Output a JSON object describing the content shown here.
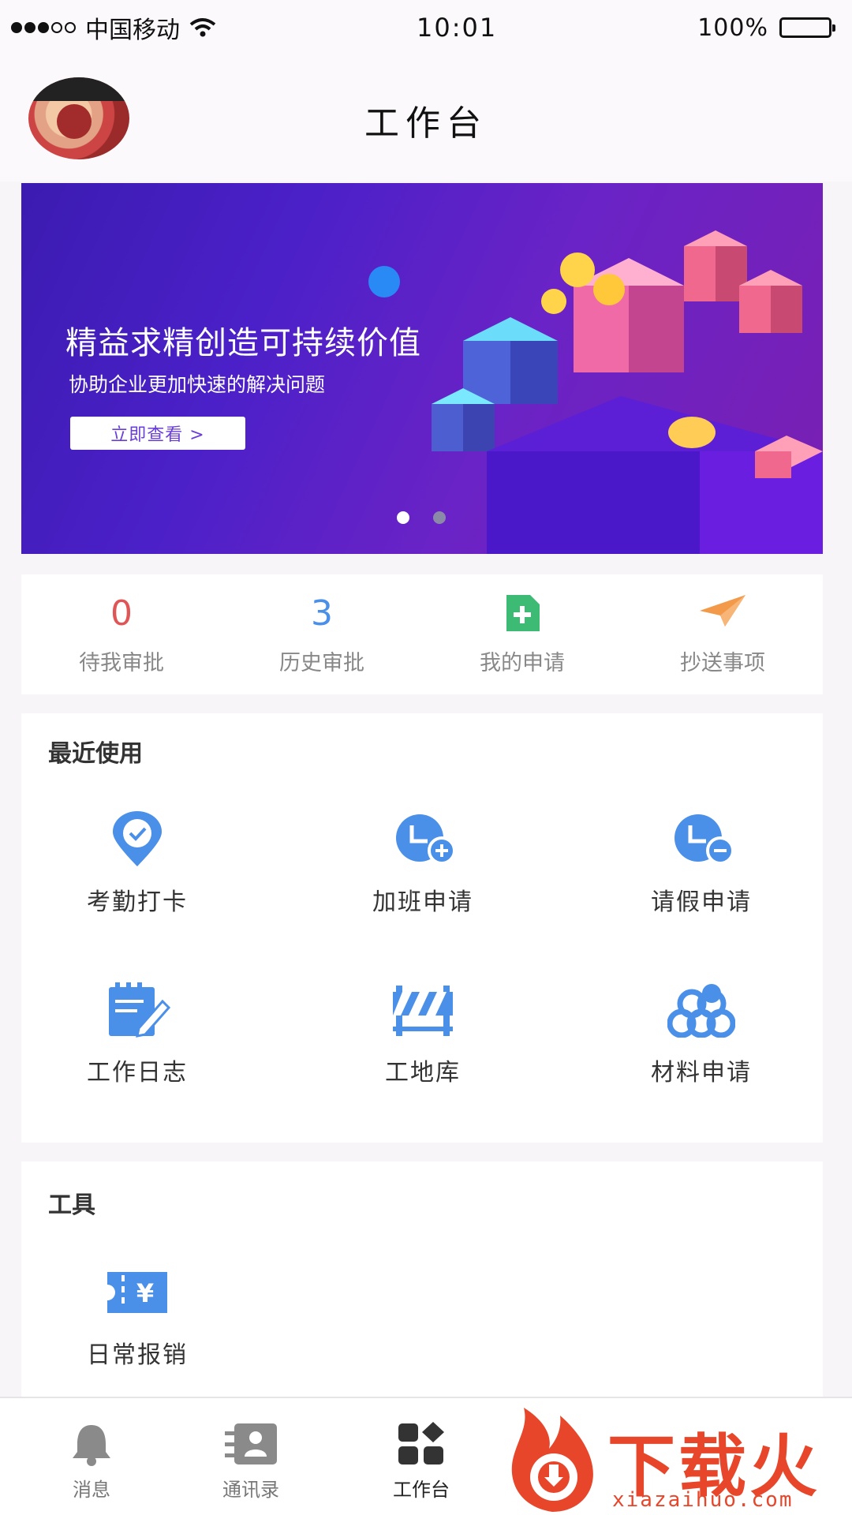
{
  "status_bar": {
    "carrier": "中国移动",
    "time": "10:01",
    "battery": "100%"
  },
  "header": {
    "title": "工作台"
  },
  "banner": {
    "title": "精益求精创造可持续价值",
    "subtitle": "协助企业更加快速的解决问题",
    "button_label": "立即查看 >",
    "active_slide": 1,
    "slide_count": 2
  },
  "stats": [
    {
      "value": "0",
      "label": "待我审批",
      "color": "#e05555"
    },
    {
      "value": "3",
      "label": "历史审批",
      "color": "#4a8fe8"
    },
    {
      "value": "",
      "label": "我的申请",
      "icon": "add-document-icon",
      "color": "#3dba74"
    },
    {
      "value": "",
      "label": "抄送事项",
      "icon": "paper-plane-icon",
      "color": "#f39a4a"
    }
  ],
  "recent": {
    "title": "最近使用",
    "items": [
      {
        "label": "考勤打卡",
        "icon": "location-check-icon"
      },
      {
        "label": "加班申请",
        "icon": "clock-plus-icon"
      },
      {
        "label": "请假申请",
        "icon": "clock-minus-icon"
      },
      {
        "label": "工作日志",
        "icon": "notepad-pen-icon"
      },
      {
        "label": "工地库",
        "icon": "road-barrier-icon"
      },
      {
        "label": "材料申请",
        "icon": "material-rolls-icon"
      }
    ]
  },
  "tools": {
    "title": "工具",
    "items": [
      {
        "label": "日常报销",
        "icon": "yuan-ticket-icon"
      }
    ]
  },
  "tabbar": {
    "items": [
      {
        "label": "消息",
        "icon": "bell-icon"
      },
      {
        "label": "通讯录",
        "icon": "contacts-icon"
      },
      {
        "label": "工作台",
        "icon": "workbench-icon",
        "active": true
      }
    ]
  },
  "watermark": {
    "text": "下载火",
    "url": "xiazaihuo.com"
  },
  "colors": {
    "icon_blue": "#4a8fe8",
    "banner_start": "#3b1bb1",
    "banner_end": "#7a1fb2"
  }
}
